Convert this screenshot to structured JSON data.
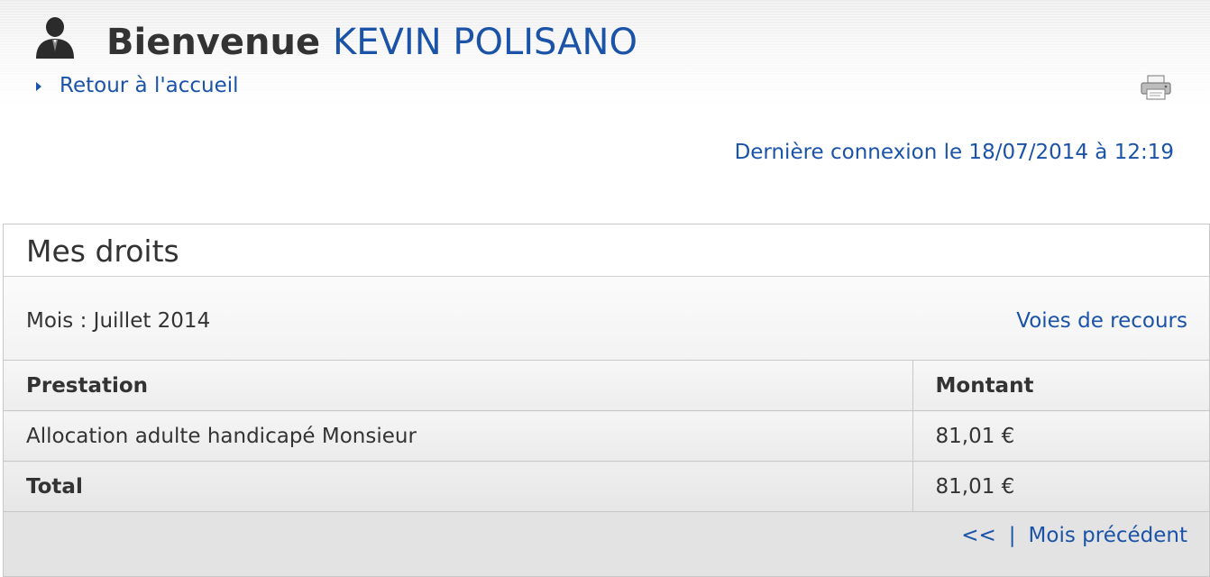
{
  "header": {
    "avatar_icon": "user-silhouette-icon",
    "welcome": "Bienvenue",
    "user_name": "KEVIN POLISANO",
    "home_link": "Retour à l'accueil",
    "home_arrow_icon": "triangle-right-icon",
    "print_icon": "printer-icon",
    "last_login": "Dernière connexion le 18/07/2014 à 12:19"
  },
  "panel": {
    "title": "Mes droits",
    "month": "Mois : Juillet 2014",
    "recourse_link": "Voies de recours",
    "columns": [
      "Prestation",
      "Montant"
    ],
    "rows": [
      {
        "prestation": "Allocation adulte handicapé Monsieur",
        "montant": "81,01 €"
      }
    ],
    "total": {
      "label": "Total",
      "montant": "81,01 €"
    },
    "pager": {
      "prev_arrows": "<<",
      "separator": "|",
      "prev_label": "Mois précédent"
    }
  },
  "colors": {
    "link": "#1a53a7",
    "text": "#333333",
    "border": "#c8c8c8"
  }
}
